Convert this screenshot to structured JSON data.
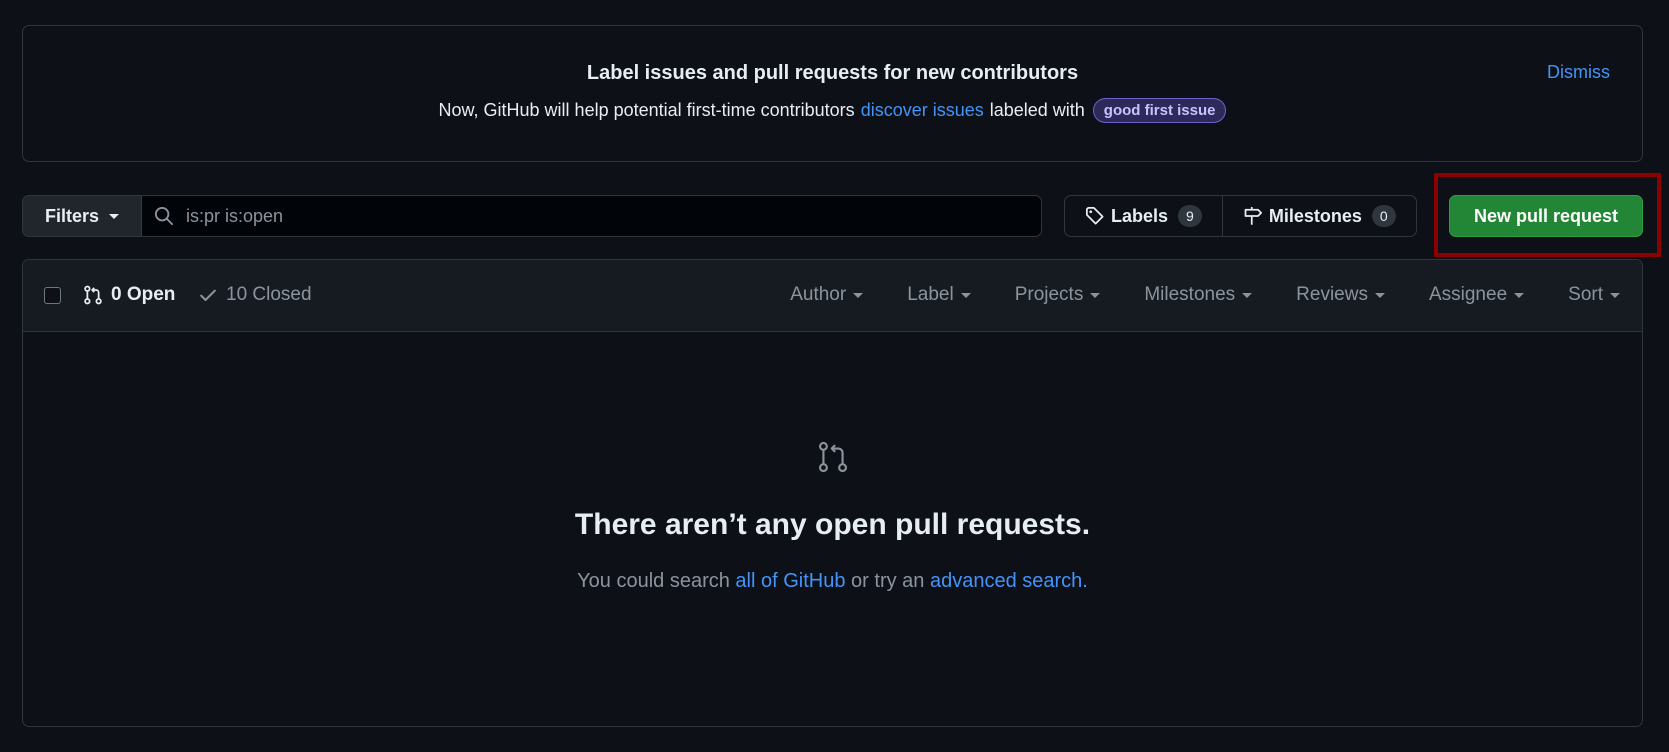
{
  "banner": {
    "title": "Label issues and pull requests for new contributors",
    "desc_prefix": "Now, GitHub will help potential first-time contributors",
    "desc_link": "discover issues",
    "desc_middle": "labeled with",
    "label": "good first issue",
    "dismiss": "Dismiss"
  },
  "filters": {
    "button_label": "Filters",
    "search_value": "is:pr is:open",
    "labels_label": "Labels",
    "labels_count": "9",
    "milestones_label": "Milestones",
    "milestones_count": "0",
    "new_pr_label": "New pull request"
  },
  "list_header": {
    "open_label": "0 Open",
    "closed_label": "10 Closed",
    "filters": [
      "Author",
      "Label",
      "Projects",
      "Milestones",
      "Reviews",
      "Assignee",
      "Sort"
    ]
  },
  "blankslate": {
    "title": "There aren’t any open pull requests.",
    "desc_prefix": "You could search",
    "link1": "all of GitHub",
    "desc_middle": "or try an",
    "link2": "advanced search",
    "desc_suffix": "."
  },
  "colors": {
    "background": "#0d1117",
    "accent_link": "#4493f8",
    "primary_button": "#238636",
    "highlight_frame": "#8b0000"
  },
  "icons": [
    "search-icon",
    "tag-icon",
    "milestone-icon",
    "git-pull-request-icon",
    "check-icon",
    "caret-down-icon"
  ]
}
